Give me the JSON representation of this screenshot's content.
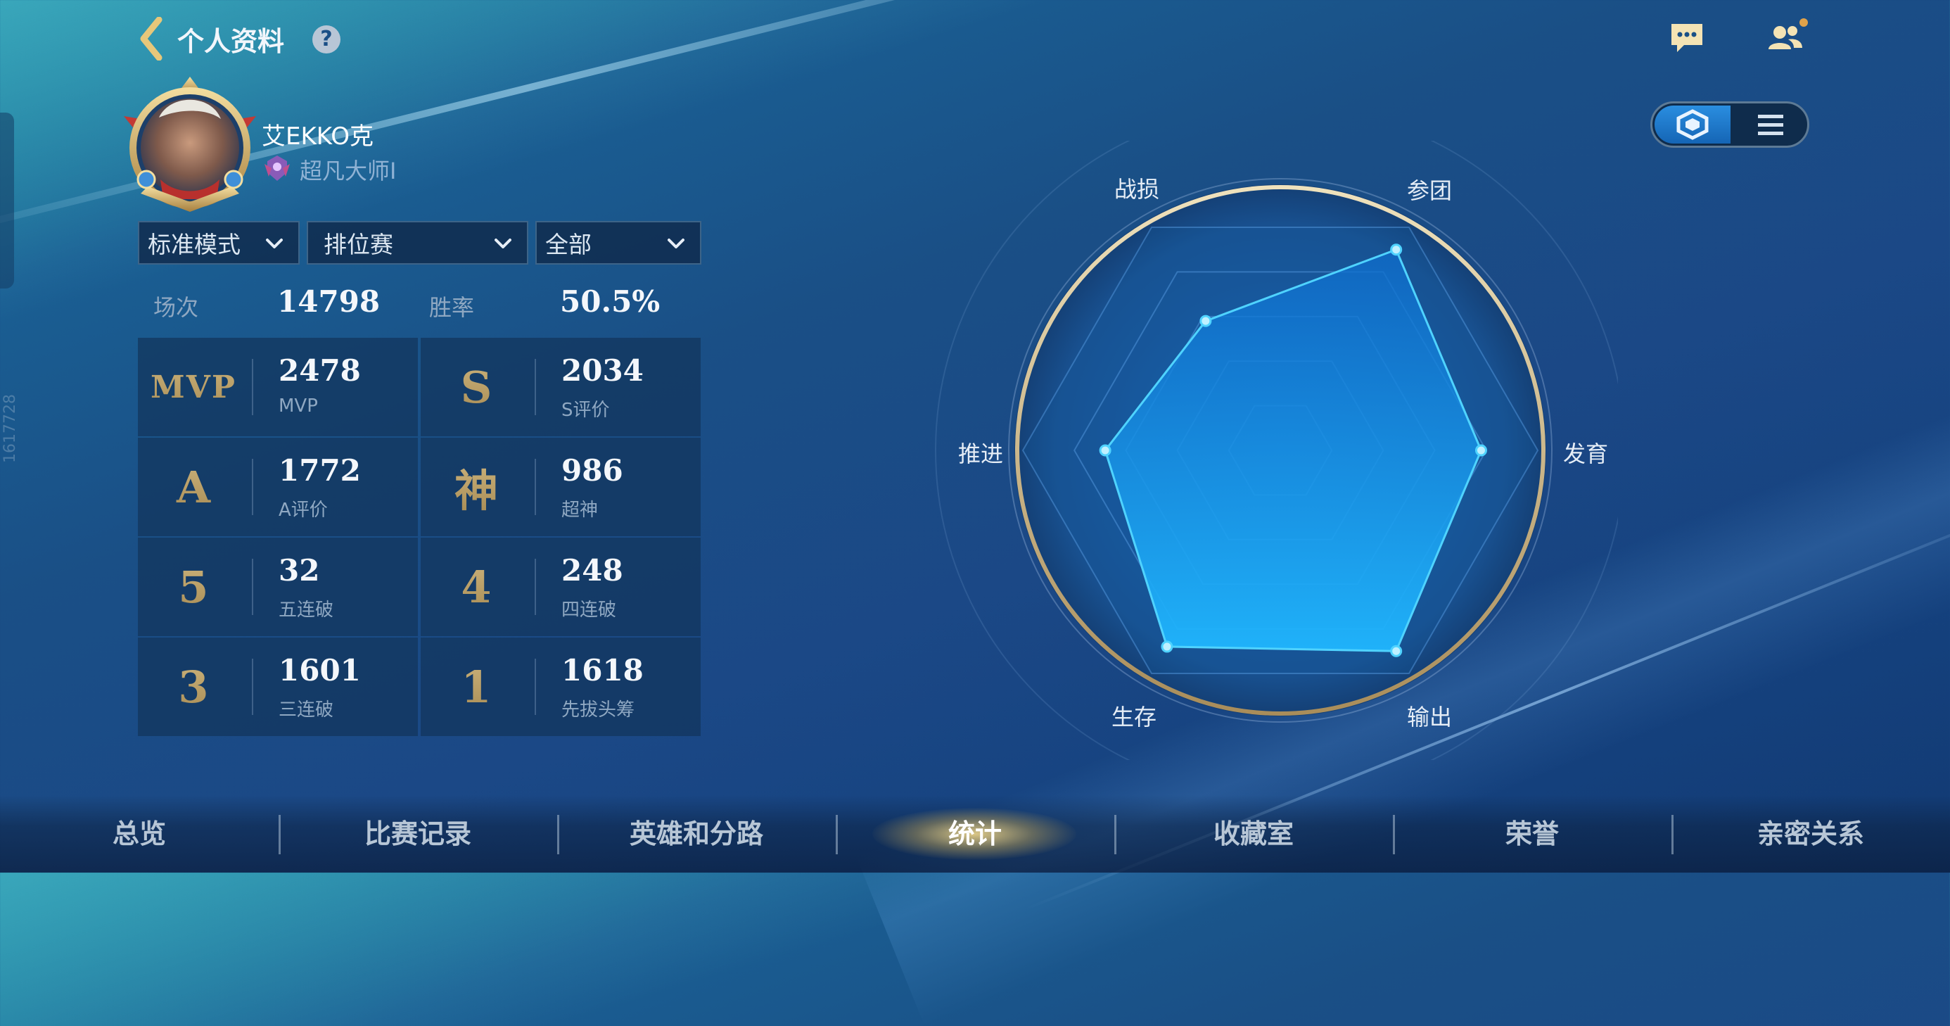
{
  "header": {
    "title": "个人资料",
    "help_label": "?",
    "side_id": "1617728"
  },
  "profile": {
    "name": "艾EKKO克",
    "rank": "超凡大师I"
  },
  "filters": {
    "mode": "标准模式",
    "match_type": "排位赛",
    "scope": "全部"
  },
  "summary": {
    "matches_label": "场次",
    "matches_value": "14798",
    "winrate_label": "胜率",
    "winrate_value": "50.5%"
  },
  "stats": [
    {
      "badge": "MVP",
      "value": "2478",
      "label": "MVP"
    },
    {
      "badge": "S",
      "value": "2034",
      "label": "S评价"
    },
    {
      "badge": "A",
      "value": "1772",
      "label": "A评价"
    },
    {
      "badge": "神",
      "value": "986",
      "label": "超神"
    },
    {
      "badge": "5",
      "value": "32",
      "label": "五连破"
    },
    {
      "badge": "4",
      "value": "248",
      "label": "四连破"
    },
    {
      "badge": "3",
      "value": "1601",
      "label": "三连破"
    },
    {
      "badge": "1",
      "value": "1618",
      "label": "先拔头筹"
    }
  ],
  "radar": {
    "axes": [
      "战损",
      "参团",
      "发育",
      "输出",
      "生存",
      "推进"
    ],
    "values": [
      0.58,
      0.9,
      0.78,
      0.9,
      0.88,
      0.68
    ]
  },
  "tabs": [
    {
      "label": "总览",
      "active": false
    },
    {
      "label": "比赛记录",
      "active": false
    },
    {
      "label": "英雄和分路",
      "active": false
    },
    {
      "label": "统计",
      "active": true
    },
    {
      "label": "收藏室",
      "active": false
    },
    {
      "label": "荣誉",
      "active": false
    },
    {
      "label": "亲密关系",
      "active": false
    }
  ],
  "colors": {
    "accent_gold": "#d8c089",
    "radar_fill": "#1aa7f0",
    "radar_stroke": "#4fd3ff",
    "ring_gold": "#c9b07a"
  },
  "icons": {
    "back": "chevron-left-icon",
    "chat": "chat-bubble-icon",
    "friends": "friends-icon",
    "radar_view": "hexagon-icon",
    "list_view": "list-icon"
  }
}
